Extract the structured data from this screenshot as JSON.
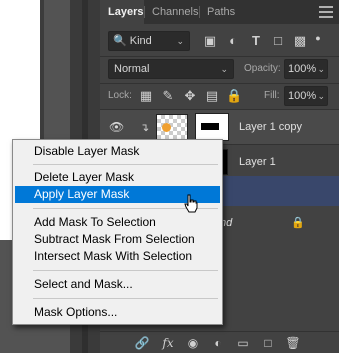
{
  "panel": {
    "tabs": [
      {
        "label": "Layers",
        "active": true
      },
      {
        "label": "Channels",
        "active": false
      },
      {
        "label": "Paths",
        "active": false
      }
    ],
    "filter": {
      "icon": "search-icon",
      "value": "Kind"
    },
    "blend_mode": "Normal",
    "opacity": {
      "label": "Opacity:",
      "value": "100%"
    },
    "lock": {
      "label": "Lock:"
    },
    "fill": {
      "label": "Fill:",
      "value": "100%"
    }
  },
  "layers": [
    {
      "name": "Layer 1 copy",
      "visible": true,
      "has_mask": true,
      "selected": false
    },
    {
      "name": "Layer 1",
      "visible": true,
      "has_mask": false,
      "selected": false
    },
    {
      "name": "",
      "selected": true
    },
    {
      "name": "nd",
      "locked": true
    }
  ],
  "context_menu": {
    "items": [
      {
        "label": "Disable Layer Mask"
      },
      {
        "label": "Delete Layer Mask"
      },
      {
        "label": "Apply Layer Mask",
        "highlighted": true
      },
      {
        "label": "Add Mask To Selection"
      },
      {
        "label": "Subtract Mask From Selection"
      },
      {
        "label": "Intersect Mask With Selection"
      },
      {
        "label": "Select and Mask..."
      },
      {
        "label": "Mask Options..."
      }
    ]
  },
  "colors": {
    "menu_highlight": "#0078d7",
    "selected_layer": "#39476b",
    "panel_bg": "#424242"
  }
}
